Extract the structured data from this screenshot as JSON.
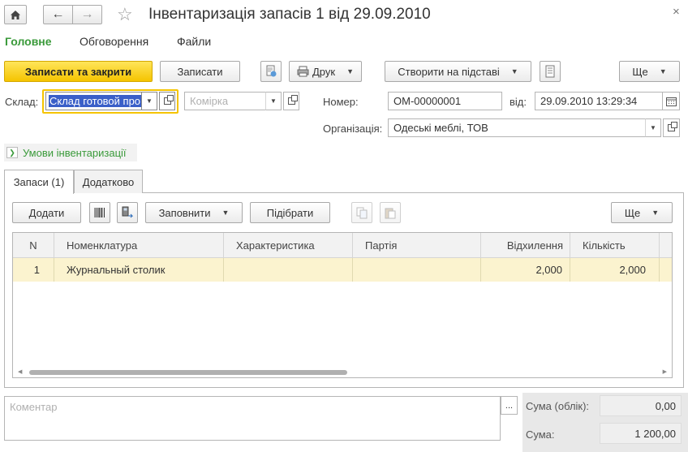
{
  "window": {
    "title": "Інвентаризація запасів 1 від 29.09.2010"
  },
  "nav_tabs": [
    "Головне",
    "Обговорення",
    "Файли"
  ],
  "toolbar": {
    "save_close": "Записати та закрити",
    "save": "Записати",
    "print": "Друк",
    "create_based": "Створити на підставі",
    "more": "Ще"
  },
  "form": {
    "warehouse_label": "Склад:",
    "warehouse_value": "Склад готовой про",
    "cell_placeholder": "Комірка",
    "number_label": "Номер:",
    "number_value": "ОМ-00000001",
    "date_label": "від:",
    "date_value": "29.09.2010 13:29:34",
    "org_label": "Організація:",
    "org_value": "Одеські меблі, ТОВ",
    "conditions_link": "Умови інвентаризації"
  },
  "tabs": [
    "Запаси (1)",
    "Додатково"
  ],
  "table_toolbar": {
    "add": "Додати",
    "fill": "Заповнити",
    "pick": "Підібрати",
    "more": "Ще"
  },
  "table": {
    "columns": [
      "N",
      "Номенклатура",
      "Характеристика",
      "Партія",
      "Відхилення",
      "Кількість"
    ],
    "rows": [
      [
        "1",
        "Журнальный столик",
        "",
        "",
        "2,000",
        "2,000"
      ]
    ]
  },
  "footer": {
    "comment_placeholder": "Коментар",
    "comment_btn": "...",
    "sum_account_label": "Сума (облік):",
    "sum_account_value": "0,00",
    "sum_label": "Сума:",
    "sum_value": "1 200,00"
  },
  "colors": {
    "accent_green": "#3a9a3a",
    "primary_button": "#f5c400",
    "selected_row": "#fbf3cf",
    "focus_border": "#f5c400"
  }
}
